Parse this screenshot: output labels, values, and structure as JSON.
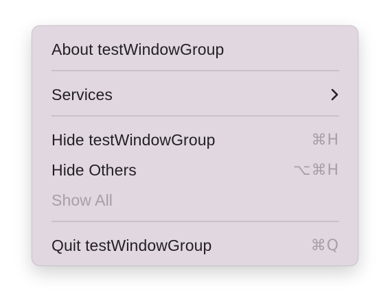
{
  "menu": {
    "about": {
      "label": "About testWindowGroup"
    },
    "services": {
      "label": "Services",
      "submenu_icon": "chevron-right-icon"
    },
    "hide": {
      "label": "Hide testWindowGroup",
      "shortcut": "⌘H"
    },
    "hide_others": {
      "label": "Hide Others",
      "shortcut": "⌥⌘H"
    },
    "show_all": {
      "label": "Show All",
      "enabled": false
    },
    "quit": {
      "label": "Quit testWindowGroup",
      "shortcut": "⌘Q"
    }
  },
  "colors": {
    "menu_background": "#e0d7e0",
    "text": "#231f24",
    "disabled_text": "#a69fa7",
    "separator": "#c9c0c9"
  }
}
